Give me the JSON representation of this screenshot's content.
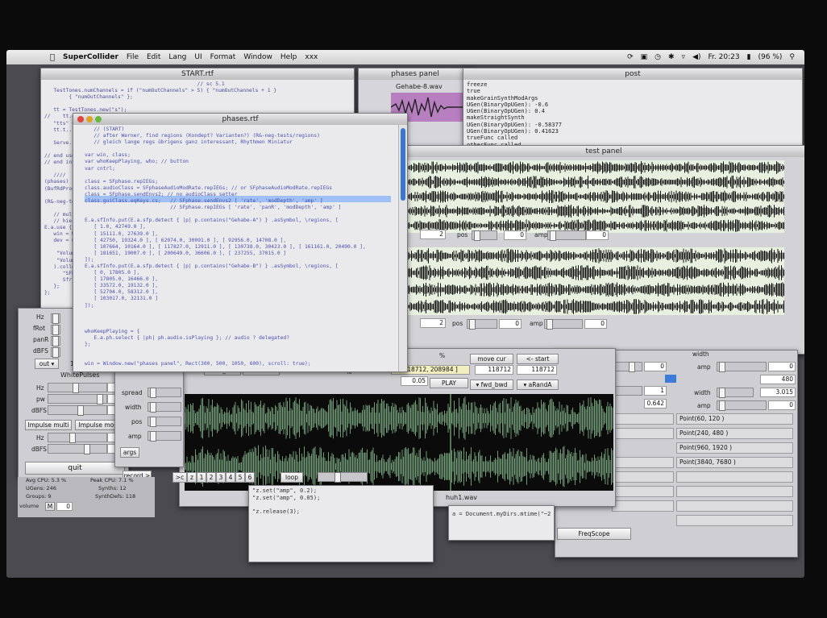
{
  "menubar": {
    "app_name": "SuperCollider",
    "items": [
      "File",
      "Edit",
      "Lang",
      "UI",
      "Format",
      "Window",
      "Help",
      "xxx"
    ],
    "clock": "Fr. 20:23",
    "battery": "(96 %)"
  },
  "windows": {
    "start_title": "START.rtf",
    "phases_rtf_title": "phases.rtf",
    "phases_panel_title": "phases panel",
    "post_title": "post",
    "test_panel_title": "test panel",
    "sound_file_a": "Gehabe-8.wav",
    "sound_file_b": "huh1.wav"
  },
  "start_code": [
    "                                                  // sc 5.1",
    "   TestTones.numChannels = if (\"numOutChannels\" > 5) { \"numOutChannels + 1 }",
    "        { \"numOutChannels\" };",
    "",
    "   tt = TestTones.new(\"s\");",
    "//    tt.out = \"baseOut\" // pure? maybe better directly to hardware ... ?",
    "   \"tts\" = ...",
    "   tt.t...",
    "",
    "   Serve...",
    "",
    "// end use",
    "// end introduction",
    "",
    "   ////",
    "(phases)",
    "(BufRdProc-Grain...)",
    "",
    "(R&-neg-tests/...)",
    "",
    "   // multi dir...",
    "   // hier else...",
    "E.a.use { [colli...",
    "   win = Window...",
    "   dev = win.pad...",
    "",
    "    \"Volumes...",
    "    \"Volume...",
    "   ).collect {",
    "      \"SFPla...",
    "      Sfr...",
    "   };",
    "};"
  ],
  "phases_code": [
    "   // (START)",
    "   // after Werner, find regions (Kondept? Varianten?) (R&-neg-tests/regions)",
    "   // gleich lange regs übrigens ganz interessant, Rhythmen Miniatur",
    "",
    "var win, class;",
    "var whoKeepPlaying, who; // button",
    "var cntrl;",
    "",
    "class = SFphase.repIEGs;",
    "class.audioClass = SFphaseAudioModRate.repIEGs; // or SFphaseAudioModRate.repIEGs",
    "class = SFphase.sendEnvs2; // no audioClass setter",
    "class.guiClass.eqKeys.cs;   // SFphase.sendEnvs2 [ 'rate', 'modDepth', 'amp' ]",
    "                            // SFphase.repIEGs [ 'rate', 'panR', 'modDepth', 'amp' ]",
    "",
    "E.a.sfInfo.put(E.a.sfp.detect { |p| p.contains(\"Gehabe-A\") } .asSymbol, \\regions, [",
    "   [ 1.0, 42749.0 ],",
    "   [ 15111.0, 27639.0 ],",
    "   [ 42750, 19324.0 ], [ 62074.0, 30091.0 ], [ 92956.0, 14708.0 ],",
    "   [ 107664, 10164.0 ], [ 117827.0, 12911.0 ], [ 130738.0, 30423.0 ], [ 161161.0, 20490.0 ],",
    "   [ 181651, 19007.0 ], [ 200649.0, 36606.0 ], [ 237255, 37015.0 ]",
    "]);",
    "E.a.sfInfo.put(E.a.sfp.detect { |p| p.contains(\"Gehabe-B\") } .asSymbol, \\regions, [",
    "   [ 0, 17805.0 ],",
    "   [ 17805.0, 16466.0 ],",
    "   [ 33572.0, 19132.0 ],",
    "   [ 52704.0, 58312.0 ],",
    "   [ 103017.0, 32131.0 ]",
    "]);",
    "",
    "",
    "",
    "whoKeepPlaying = {",
    "   E.a.ph.select { |ph| ph.audio.isPlaying }; // audio ? delegated?",
    "};",
    "",
    "",
    "win = Window.new(\"phases panel\", Rect(300, 500, 1050, 600), scroll: true);"
  ],
  "post_lines": [
    "freeze",
    "true",
    "makeGrainSynthModArgs",
    "UGen(BinaryOpUGen): -0.6",
    "UGen(BinaryOpUGen): 0.4",
    "makeStraightSynth",
    "UGen(BinaryOpUGen): -0.58377",
    "UGen(BinaryOpUGen): 0.41623",
    "trueFunc called",
    "otherFunc called"
  ],
  "test_panel": {
    "row1": {
      "field": "2",
      "pos_label": "pos",
      "pos_value": "0",
      "amp_label": "amp",
      "amp_value": "0"
    },
    "row2": {
      "field": "2",
      "pos_label": "pos",
      "pos_value": "0",
      "amp_label": "amp",
      "amp_value": "0"
    }
  },
  "player": {
    "pct1": "%",
    "pct2": "%",
    "move_cur": "move cur",
    "start": "<- start",
    "range": "0 [ 118712, 208984 ]",
    "val1": "118712",
    "val2": "118712",
    "step": "0.05",
    "play": "PLAY",
    "mode": "fwd_bwd",
    "rand": "aRandA",
    "mode2": "fwd_bwd",
    "wave": "wave",
    "pct3": "%",
    "pct4": "%",
    "pager": [
      ">c",
      "z",
      "1",
      "2",
      "3",
      "4",
      "5",
      "6"
    ],
    "loop": "loop"
  },
  "right_panel": {
    "spread": "spread",
    "pos": "pos",
    "val240": "240",
    "spread2": "spread",
    "val0": "0",
    "val1": "1",
    "val0642": "0.642",
    "width": "width",
    "amp": "amp",
    "amp_val": "0",
    "val480": "480",
    "width2": "width",
    "width_val": "3.015",
    "amp2": "amp",
    "amp2_val": "0",
    "points": [
      "Point(60, 120 )",
      "Point(240, 480 )",
      "Point(960, 1920 )",
      "Point(3840, 7680 )"
    ],
    "freqscope": "FreqScope"
  },
  "left_panel": {
    "labels": [
      "Hz",
      "fRot",
      "panR",
      "dBFS"
    ],
    "out_label": "out",
    "out_value": "1",
    "out_value2": "2",
    "white_pulses": "WhitePulses",
    "hz": "Hz",
    "hz_val": "5",
    "pw": "pw",
    "pw_val": "0.9",
    "dbfs": "dBFS",
    "dbfs_val": "-20",
    "impulse_multi": "Impulse multi",
    "impulse_mono": "Impulse mono",
    "hz2": "Hz",
    "hz2_val": "2",
    "dbfs2": "dBFS",
    "dbfs2_val": "-12",
    "quit": "quit",
    "stats": [
      "Avg CPU: 5.3 %",
      "Peak CPU: 7.1 %",
      "UGens: 246",
      "Synths: 12",
      "Groups: 9",
      "SynthDefs: 118"
    ],
    "volume": "volume",
    "record": "record >"
  },
  "mid_panel": {
    "spread": "spread",
    "width": "width",
    "pos": "pos",
    "amp": "amp",
    "args": "args"
  },
  "bottom_code": [
    "\"z.set(\"amp\", 0.2);",
    "\"z.set(\"amp\", 0.05);",
    "",
    "\"z.release(3);"
  ],
  "doc_code": "a = Document.myDirs.mtime(\"~2"
}
